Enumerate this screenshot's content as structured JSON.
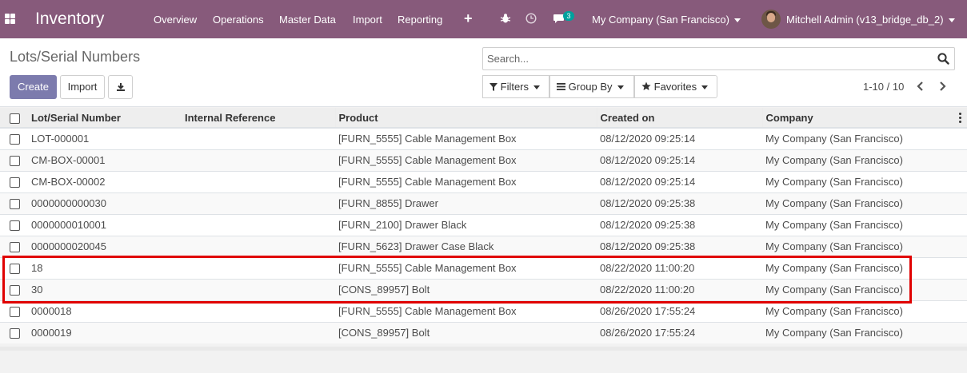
{
  "nav": {
    "app_title": "Inventory",
    "menus": [
      "Overview",
      "Operations",
      "Master Data",
      "Import",
      "Reporting"
    ],
    "add_icon": "plus-icon",
    "debug_icon": "bug-icon",
    "activity_icon": "clock-icon",
    "messages_icon": "chat-icon",
    "messages_count": "3",
    "company": "My Company (San Francisco)",
    "user": "Mitchell Admin (v13_bridge_db_2)"
  },
  "control": {
    "breadcrumb": "Lots/Serial Numbers",
    "create_label": "Create",
    "import_label": "Import",
    "download_icon": "download-icon",
    "search_placeholder": "Search...",
    "filters_label": "Filters",
    "group_by_label": "Group By",
    "favorites_label": "Favorites",
    "pager_text": "1-10 / 10"
  },
  "table": {
    "headers": [
      "Lot/Serial Number",
      "Internal Reference",
      "Product",
      "Created on",
      "Company"
    ],
    "rows": [
      {
        "lot": "LOT-000001",
        "ref": "",
        "product": "[FURN_5555] Cable Management Box",
        "created": "08/12/2020 09:25:14",
        "company": "My Company (San Francisco)"
      },
      {
        "lot": "CM-BOX-00001",
        "ref": "",
        "product": "[FURN_5555] Cable Management Box",
        "created": "08/12/2020 09:25:14",
        "company": "My Company (San Francisco)"
      },
      {
        "lot": "CM-BOX-00002",
        "ref": "",
        "product": "[FURN_5555] Cable Management Box",
        "created": "08/12/2020 09:25:14",
        "company": "My Company (San Francisco)"
      },
      {
        "lot": "0000000000030",
        "ref": "",
        "product": "[FURN_8855] Drawer",
        "created": "08/12/2020 09:25:38",
        "company": "My Company (San Francisco)"
      },
      {
        "lot": "0000000010001",
        "ref": "",
        "product": "[FURN_2100] Drawer Black",
        "created": "08/12/2020 09:25:38",
        "company": "My Company (San Francisco)"
      },
      {
        "lot": "0000000020045",
        "ref": "",
        "product": "[FURN_5623] Drawer Case Black",
        "created": "08/12/2020 09:25:38",
        "company": "My Company (San Francisco)"
      },
      {
        "lot": "18",
        "ref": "",
        "product": "[FURN_5555] Cable Management Box",
        "created": "08/22/2020 11:00:20",
        "company": "My Company (San Francisco)"
      },
      {
        "lot": "30",
        "ref": "",
        "product": "[CONS_89957] Bolt",
        "created": "08/22/2020 11:00:20",
        "company": "My Company (San Francisco)"
      },
      {
        "lot": "0000018",
        "ref": "",
        "product": "[FURN_5555] Cable Management Box",
        "created": "08/26/2020 17:55:24",
        "company": "My Company (San Francisco)"
      },
      {
        "lot": "0000019",
        "ref": "",
        "product": "[CONS_89957] Bolt",
        "created": "08/26/2020 17:55:24",
        "company": "My Company (San Francisco)"
      }
    ]
  },
  "colors": {
    "navbar": "#875a7b",
    "primary_button": "#7c7bad",
    "highlight_box": "#e00000",
    "badge": "#00a09d"
  }
}
